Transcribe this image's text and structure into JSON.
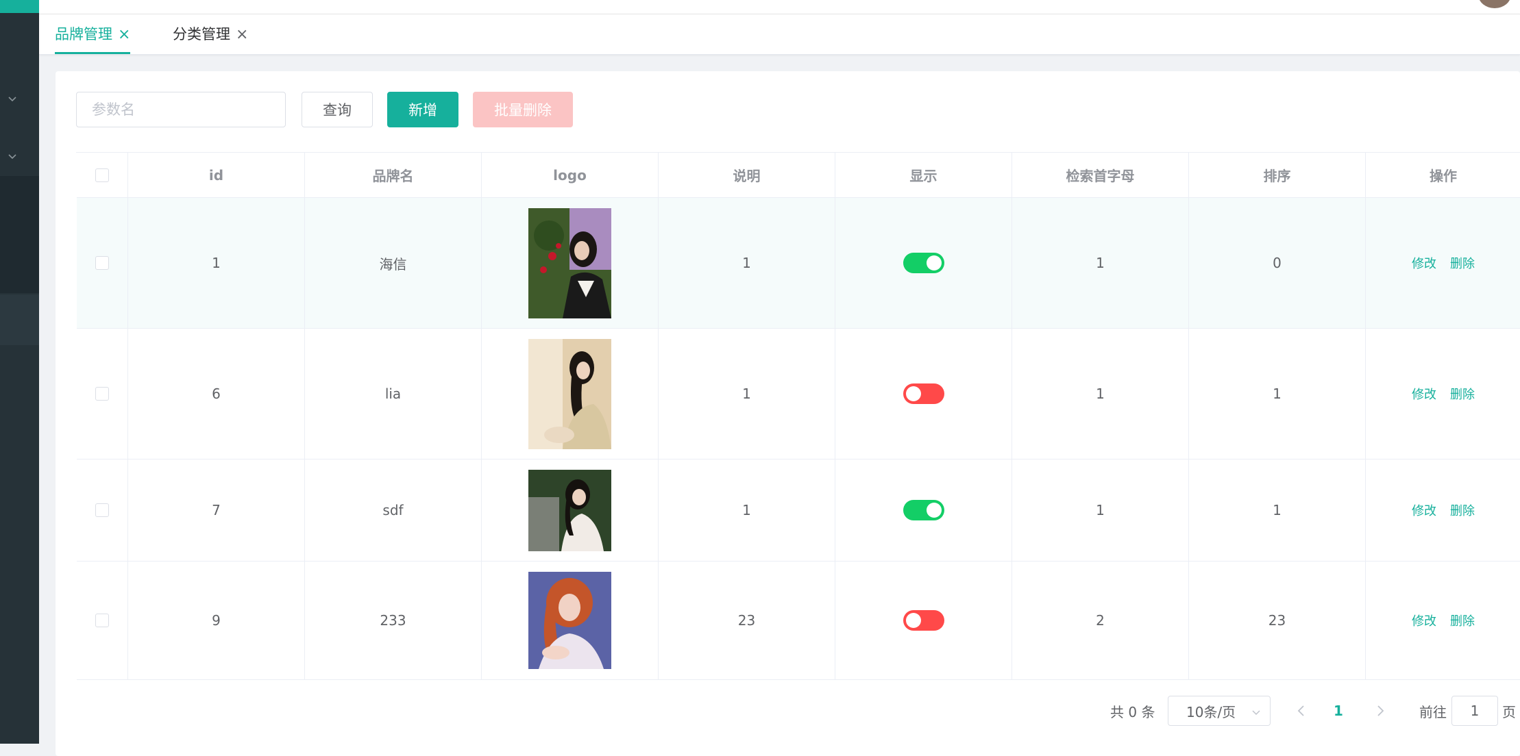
{
  "tabs": [
    {
      "label": "品牌管理",
      "active": true
    },
    {
      "label": "分类管理",
      "active": false
    }
  ],
  "toolbar": {
    "search_placeholder": "参数名",
    "query_label": "查询",
    "add_label": "新增",
    "batch_delete_label": "批量删除"
  },
  "table": {
    "columns": [
      "id",
      "品牌名",
      "logo",
      "说明",
      "显示",
      "检索首字母",
      "排序",
      "操作"
    ],
    "rows": [
      {
        "id": "1",
        "name": "海信",
        "desc": "1",
        "show": true,
        "letter": "1",
        "sort": "0"
      },
      {
        "id": "6",
        "name": "lia",
        "desc": "1",
        "show": false,
        "letter": "1",
        "sort": "1"
      },
      {
        "id": "7",
        "name": "sdf",
        "desc": "1",
        "show": true,
        "letter": "1",
        "sort": "1"
      },
      {
        "id": "9",
        "name": "233",
        "desc": "23",
        "show": false,
        "letter": "2",
        "sort": "23"
      }
    ],
    "edit_label": "修改",
    "delete_label": "删除"
  },
  "pagination": {
    "total_text": "共 0 条",
    "page_size": "10条/页",
    "current_page": "1",
    "goto_prefix": "前往",
    "goto_value": "1",
    "goto_suffix": "页"
  },
  "colors": {
    "primary": "#16b09c",
    "sidebar": "#263238",
    "switch_on": "#13ce66",
    "switch_off": "#ff4949"
  }
}
